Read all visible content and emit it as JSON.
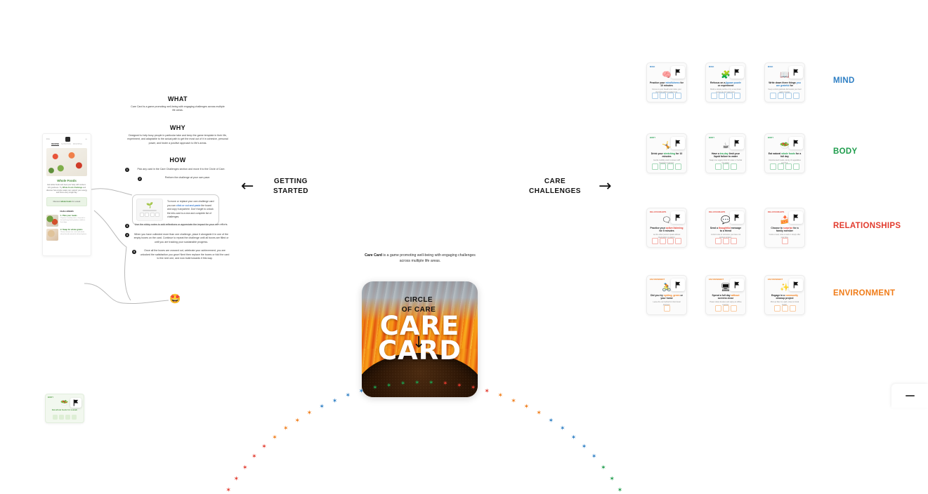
{
  "board": {
    "center_card": {
      "title_line1": "CARE",
      "title_line2": "CARD",
      "image_alt": "sunflower-photo",
      "caption_bold": "Care Card",
      "caption_rest": " is a game promoting well-being with engaging challenges across multiple life areas."
    },
    "nav": {
      "left_label_line1": "GETTING",
      "left_label_line2": "STARTED",
      "right_label_line1": "CARE",
      "right_label_line2": "CHALLENGES",
      "bottom_label_line1": "CIRCLE",
      "bottom_label_line2": "OF CARE",
      "left_arrow": "←",
      "right_arrow": "→",
      "down_arrow": "↓"
    }
  },
  "getting_started": {
    "what": {
      "heading": "WHAT",
      "text": "Care Card is a game promoting well-being with engaging challenges across multiple life areas."
    },
    "why": {
      "heading": "WHY",
      "text": "Designed to help busy people in particular take and keep the game template in their life, experiment, and adaptable to the actual path to get the most out of it in cohesive, personal power, and foster a positive approach to life's areas."
    },
    "how": {
      "heading": "HOW",
      "steps": [
        {
          "num": "1",
          "text": "Pick any card in the Care Challenges section and move it to the Circle of Care."
        },
        {
          "num": "2",
          "text": "Perform the challenge at your own pace."
        },
        {
          "num": "3",
          "text": "Use the sticky notes to add reflections or appreciate the impact for your own efforts."
        },
        {
          "num": "4",
          "text": "When you have collected more than one challenge, place it alongside it in one of the empty boxes on the card. Continue to repeat the challenge until all boxes are filled or until you are tracking your sustainable progress."
        },
        {
          "num": "5",
          "text": "Once all the boxes are crossed out, celebrate your achievement, you are unlocked the satisfaction you grow! Next then replace the boxes or fold the card to the next one, and now build towards it this way."
        }
      ],
      "callout": {
        "text_before": "To move or replace your own challenge card you can ",
        "text_link": "click or cut and paste",
        "text_after": " the board and copy it anywhere. Don't forget to unlock the info-card to a new and complete list of challenges.",
        "card_glyph": "🌱"
      }
    },
    "app_mock": {
      "status_left": "9:41",
      "status_right": "•••",
      "tabs": [
        "RECIPES",
        "NUTRITION",
        "SHOPPING"
      ],
      "active_tab": "RECIPES",
      "heading": "Whole Foods",
      "paragraph_before": "Eat whole foods and feed your body with nutrient-rich goodness. Try ",
      "paragraph_link": "Whole Foods Challenge",
      "paragraph_after": " and discover how simple swaps can support your energy and focus every single day.",
      "cta_before": "Discover ",
      "cta_bold": "whole foods",
      "cta_after": " for a week",
      "section_title": "CHALLENGES",
      "items": [
        {
          "title": "1. Plan your meals",
          "desc": "Prepare a weekly menu, shop with a list and keep fresh produce visible in the fridge."
        },
        {
          "title": "2. Swap for whole grains",
          "desc": "Choose brown rice, oats and whole wheat bread instead of refined options."
        }
      ]
    },
    "mini_card": {
      "tag": "BODY",
      "glyph": "🥗",
      "title": "Eat whole foods for a week",
      "boxes": 4
    },
    "emoji_node": "🤩"
  },
  "care_challenges": {
    "categories": [
      {
        "name": "MIND",
        "color": "#2e7fc4",
        "cards": [
          {
            "tag": "MIND",
            "glyph": "🧠",
            "title_before": "Practice your ",
            "title_link": "mindfulness",
            "title_after": " for 10 minutes",
            "subtitle": "Focus on your breath and notice your thoughts without judgement.",
            "boxes": 4
          },
          {
            "tag": "MIND",
            "glyph": "🧩",
            "title_before": "Refocus on a ",
            "title_link": "jigsaw puzzle",
            "title_after": " or experiment",
            "subtitle": "Build a simple puzzle or try a new brain teaser at your own pace.",
            "boxes": 4
          },
          {
            "tag": "MIND",
            "glyph": "📖",
            "title_before": "Write down three things ",
            "title_link": "you are grateful",
            "title_after": " for",
            "subtitle": "Keep a short gratitude list beside your bed each evening.",
            "boxes": 4
          }
        ]
      },
      {
        "name": "BODY",
        "color": "#1f9d4d",
        "cards": [
          {
            "tag": "BODY",
            "glyph": "🤸",
            "title_before": "Drink your ",
            "title_link": "stretching",
            "title_after": " for 10 minutes",
            "subtitle": "Gentle mobility work to loosen stiff shoulders and hips.",
            "boxes": 4
          },
          {
            "tag": "BODY",
            "glyph": "☕",
            "title_before": "Have a ",
            "title_link": "tea-day",
            "title_after": " limit your liquid failure to water",
            "subtitle": "Swap one sugary drink for water or herbal tea today.",
            "boxes": 3
          },
          {
            "tag": "BODY",
            "glyph": "🥗",
            "title_before": "Eat natural ",
            "title_link": "whole foods",
            "title_after": " for a full day",
            "subtitle": "Unprocessed meals, plenty of vegetables and fruit.",
            "boxes": 4
          }
        ]
      },
      {
        "name": "RELATIONSHIPS",
        "color": "#e23b2e",
        "cards": [
          {
            "tag": "RELATIONSHIPS",
            "glyph": "🗨",
            "title_before": "Practice your ",
            "title_link": "active listening",
            "title_after": " for 5 minutes",
            "subtitle": "Let the other person speak without interrupting or solving.",
            "boxes": 4
          },
          {
            "tag": "RELATIONSHIPS",
            "glyph": "💬",
            "title_before": "Send a ",
            "title_link": "thoughtful",
            "title_after": " message to a friend",
            "subtitle": "A short note to someone you have not spoken to lately.",
            "boxes": 3
          },
          {
            "tag": "RELATIONSHIPS",
            "glyph": "🍰",
            "title_before": "Choose to ",
            "title_link": "surprise",
            "title_after": " for a family member",
            "subtitle": "Cook a meal, write a card or simply offer your time.",
            "boxes": 1
          }
        ]
      },
      {
        "name": "ENVIRONMENT",
        "color": "#f07c18",
        "cards": [
          {
            "tag": "ENVIRONMENT",
            "glyph": "🚴",
            "title_before": "Did you try ",
            "title_link": "cycling, green",
            "title_after": " or your home",
            "subtitle": "Leave the car behind for short local journeys.",
            "boxes": 1
          },
          {
            "tag": "ENVIRONMENT",
            "glyph": "🖥",
            "title_before": "Spend a full day ",
            "title_link": "without",
            "title_after": " screens close",
            "subtitle": "Power down devices and enjoy an offline evening.",
            "boxes": 3
          },
          {
            "tag": "ENVIRONMENT",
            "glyph": "✨",
            "title_before": "Engage in a ",
            "title_link": "community",
            "title_after": " cleanup project",
            "subtitle": "Pick up litter in a park, street or local beach.",
            "boxes": 3
          }
        ]
      }
    ]
  },
  "circle_of_care": {
    "pin_glyph": "✶",
    "arc_colors": [
      "#e23b2e",
      "#f07c18",
      "#2e7fc4",
      "#1f9d4d"
    ]
  },
  "viewport_controls": {
    "zoom_out_label": "−"
  }
}
